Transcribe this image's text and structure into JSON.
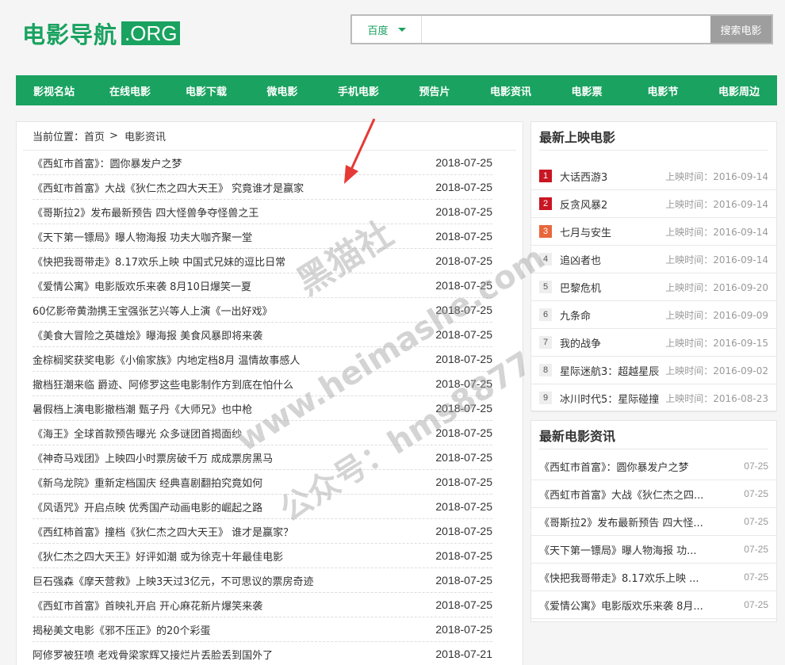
{
  "header": {
    "logo_text": "电影导航",
    "logo_badge": ".ORG",
    "search_engine": "百度",
    "search_value": "",
    "search_button": "搜索电影"
  },
  "nav": [
    "影视名站",
    "在线电影",
    "电影下载",
    "微电影",
    "手机电影",
    "预告片",
    "电影资讯",
    "电影票",
    "电影节",
    "电影周边"
  ],
  "breadcrumb": {
    "label": "当前位置：",
    "home": "首页",
    "separator": ">",
    "current": "电影资讯"
  },
  "news": [
    {
      "title": "《西虹市首富》：圆你暴发户之梦",
      "date": "2018-07-25"
    },
    {
      "title": "《西虹市首富》大战《狄仁杰之四大天王》 究竟谁才是赢家",
      "date": "2018-07-25"
    },
    {
      "title": "《哥斯拉2》发布最新预告 四大怪兽争夺怪兽之王",
      "date": "2018-07-25"
    },
    {
      "title": "《天下第一镖局》曝人物海报 功夫大咖齐聚一堂",
      "date": "2018-07-25"
    },
    {
      "title": "《快把我哥带走》8.17欢乐上映 中国式兄妹的逗比日常",
      "date": "2018-07-25"
    },
    {
      "title": "《爱情公寓》电影版欢乐来袭 8月10日爆笑一夏",
      "date": "2018-07-25"
    },
    {
      "title": "60亿影帝黄渤携王宝强张艺兴等人上演《一出好戏》",
      "date": "2018-07-25"
    },
    {
      "title": "《美食大冒险之英雄烩》曝海报 美食风暴即将来袭",
      "date": "2018-07-25"
    },
    {
      "title": "金棕榈奖获奖电影《小偷家族》内地定档8月 温情故事感人",
      "date": "2018-07-25"
    },
    {
      "title": "撤档狂潮来临 爵迹、阿修罗这些电影制作方到底在怕什么",
      "date": "2018-07-25"
    },
    {
      "title": "暑假档上演电影撤档潮 甄子丹《大师兄》也中枪",
      "date": "2018-07-25"
    },
    {
      "title": "《海王》全球首款预告曝光 众多谜团首揭面纱",
      "date": "2018-07-25"
    },
    {
      "title": "《神奇马戏团》上映四小时票房破千万 成成票房黑马",
      "date": "2018-07-25"
    },
    {
      "title": "《新乌龙院》重新定档国庆 经典喜剧翻拍究竟如何",
      "date": "2018-07-25"
    },
    {
      "title": "《风语咒》开启点映 优秀国产动画电影的崛起之路",
      "date": "2018-07-25"
    },
    {
      "title": "《西红柿首富》撞档《狄仁杰之四大天王》 谁才是赢家？",
      "date": "2018-07-25"
    },
    {
      "title": "《狄仁杰之四大天王》好评如潮 或为徐克十年最佳电影",
      "date": "2018-07-25"
    },
    {
      "title": "巨石强森《摩天营救》上映3天过3亿元，不可思议的票房奇迹",
      "date": "2018-07-25"
    },
    {
      "title": "《西虹市首富》首映礼开启 开心麻花新片爆笑来袭",
      "date": "2018-07-25"
    },
    {
      "title": "揭秘美文电影《邪不压正》的20个彩蛋",
      "date": "2018-07-25"
    },
    {
      "title": "阿修罗被狂喷 老戏骨梁家辉又接烂片丢脸丢到国外了",
      "date": "2018-07-21"
    }
  ],
  "latest_movies": {
    "title": "最新上映电影",
    "date_label": "上映时间：",
    "items": [
      {
        "rank": "1",
        "name": "大话西游3",
        "date": "2016-09-14"
      },
      {
        "rank": "2",
        "name": "反贪风暴2",
        "date": "2016-09-14"
      },
      {
        "rank": "3",
        "name": "七月与安生",
        "date": "2016-09-14"
      },
      {
        "rank": "4",
        "name": "追凶者也",
        "date": "2016-09-14"
      },
      {
        "rank": "5",
        "name": "巴黎危机",
        "date": "2016-09-20"
      },
      {
        "rank": "6",
        "name": "九条命",
        "date": "2016-09-09"
      },
      {
        "rank": "7",
        "name": "我的战争",
        "date": "2016-09-15"
      },
      {
        "rank": "8",
        "name": "星际迷航3：超越星辰",
        "date": "2016-09-02"
      },
      {
        "rank": "9",
        "name": "冰川时代5：星际碰撞",
        "date": "2016-08-23"
      }
    ]
  },
  "latest_news": {
    "title": "最新电影资讯",
    "items": [
      {
        "title": "《西虹市首富》：圆你暴发户之梦",
        "date": "07-25"
      },
      {
        "title": "《西虹市首富》大战《狄仁杰之四...",
        "date": "07-25"
      },
      {
        "title": "《哥斯拉2》发布最新预告 四大怪...",
        "date": "07-25"
      },
      {
        "title": "《天下第一镖局》曝人物海报 功...",
        "date": "07-25"
      },
      {
        "title": "《快把我哥带走》8.17欢乐上映 ...",
        "date": "07-25"
      },
      {
        "title": "《爱情公寓》电影版欢乐来袭 8月...",
        "date": "07-25"
      }
    ]
  },
  "watermark": [
    "黑猫社",
    "www.heimashe.com",
    "公众号：hms8877"
  ],
  "colors": {
    "brand": "#1aa260",
    "rank_top": "#c81623",
    "rank_third": "#e8673c",
    "annotation_arrow": "#e53935"
  }
}
